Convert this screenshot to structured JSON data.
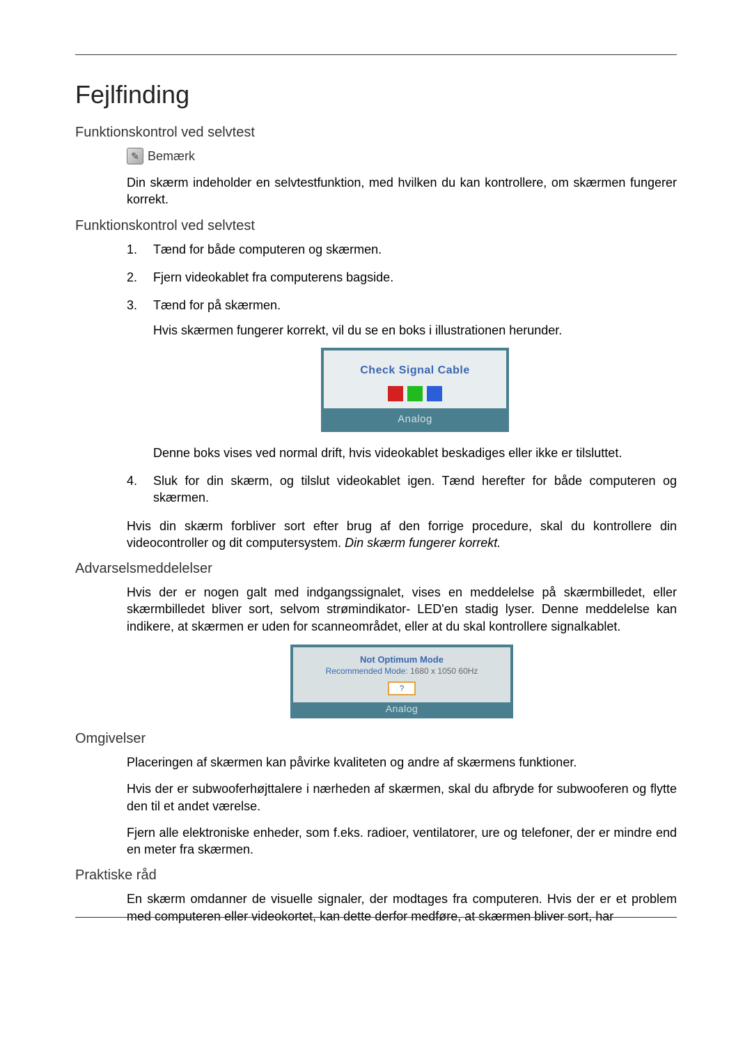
{
  "title": "Fejlfinding",
  "sections": {
    "s1": {
      "heading": "Funktionskontrol ved selvtest",
      "note_label": "Bemærk",
      "note_text": "Din skærm indeholder en selvtestfunktion, med hvilken du kan kontrollere, om skærmen fungerer korrekt."
    },
    "s2": {
      "heading": "Funktionskontrol ved selvtest",
      "items": {
        "i1": "Tænd for både computeren og skærmen.",
        "i2": "Fjern videokablet fra computerens bagside.",
        "i3a": "Tænd for på skærmen.",
        "i3b": "Hvis skærmen fungerer korrekt, vil du se en boks i illustrationen herunder.",
        "i3c": "Denne boks vises ved normal drift, hvis videokablet beskadiges eller ikke er tilsluttet.",
        "i4": "Sluk for din skærm, og tilslut videokablet igen. Tænd herefter for både computeren og skærmen."
      },
      "after_list": "Hvis din skærm forbliver sort efter brug af den forrige procedure, skal du kontrollere din videocontroller og dit computersystem. ",
      "after_list_italic": "Din skærm fungerer korrekt."
    },
    "s3": {
      "heading": "Advarselsmeddelelser",
      "text": "Hvis der er nogen galt med indgangssignalet, vises en meddelelse på skærmbilledet, eller skærmbilledet bliver sort, selvom strømindikator- LED'en stadig lyser. Denne meddelelse kan indikere, at skærmen er uden for scanneområdet, eller at du skal kontrollere signalkablet."
    },
    "s4": {
      "heading": "Omgivelser",
      "p1": "Placeringen af skærmen kan påvirke kvaliteten og andre af skærmens funktioner.",
      "p2": "Hvis der er subwooferhøjttalere i nærheden af skærmen, skal du afbryde for subwooferen og flytte den til et andet værelse.",
      "p3": "Fjern alle elektroniske enheder, som f.eks. radioer, ventilatorer, ure og telefoner, der er mindre end en meter fra skærmen."
    },
    "s5": {
      "heading": "Praktiske råd",
      "p1": "En skærm omdanner de visuelle signaler, der modtages fra computeren. Hvis der er et problem med computeren eller videokortet, kan dette derfor medføre, at skærmen bliver sort, har"
    }
  },
  "osd1": {
    "title": "Check Signal Cable",
    "footer": "Analog"
  },
  "osd2": {
    "line1": "Not Optimum Mode",
    "line2_label": "Recommended Mode",
    "line2_value": ": 1680 x  1050 60Hz",
    "button": "?",
    "footer": "Analog"
  }
}
